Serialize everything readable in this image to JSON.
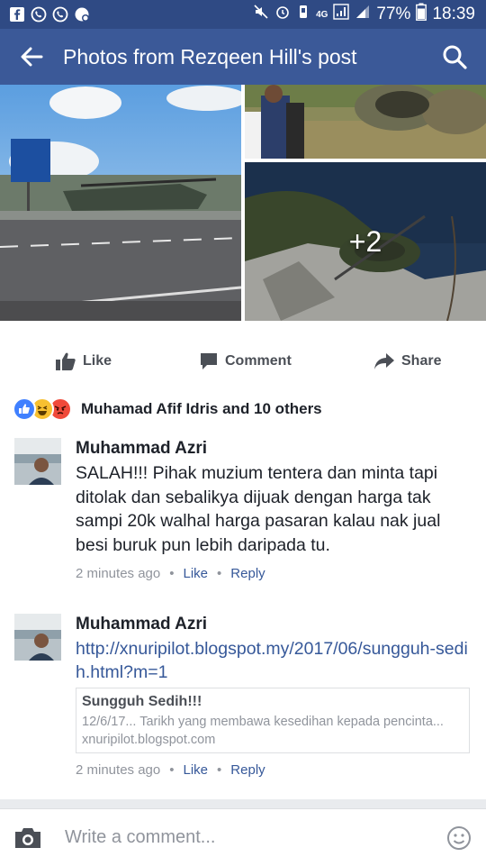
{
  "status_bar": {
    "battery": "77%",
    "time": "18:39",
    "network": "4G"
  },
  "app_bar": {
    "title": "Photos from Rezqeen Hill's post"
  },
  "photos": {
    "more_label": "+2"
  },
  "actions": {
    "like": "Like",
    "comment": "Comment",
    "share": "Share"
  },
  "reactions": {
    "summary": "Muhamad Afif Idris and 10 others"
  },
  "comments": [
    {
      "author": "Muhammad Azri",
      "text": "SALAH!!! Pihak muzium tentera dan minta tapi ditolak dan sebalikya dijuak dengan harga tak sampi 20k walhal harga pasaran kalau nak jual besi buruk pun lebih daripada tu.",
      "time": "2 minutes ago",
      "like": "Like",
      "reply": "Reply"
    },
    {
      "author": "Muhammad Azri",
      "link": "http://xnuripilot.blogspot.my/2017/06/sungguh-sedih.html?m=1",
      "preview": {
        "title": "Sungguh Sedih!!!",
        "description": "12/6/17... Tarikh yang membawa kesedihan kepada pencinta...",
        "domain": "xnuripilot.blogspot.com"
      },
      "time": "2 minutes ago",
      "like": "Like",
      "reply": "Reply"
    }
  ],
  "composer": {
    "placeholder": "Write a comment..."
  },
  "colors": {
    "status_bar": "#2f4a84",
    "app_bar": "#3b5998",
    "link": "#365899",
    "meta": "#90949c"
  }
}
